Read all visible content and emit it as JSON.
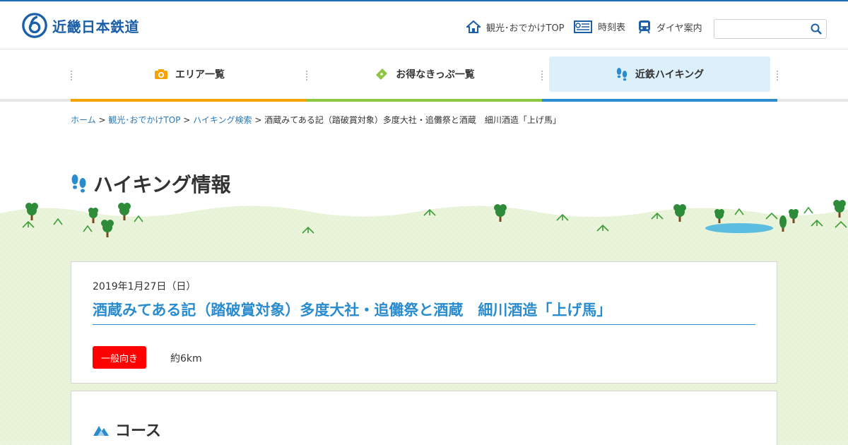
{
  "header": {
    "logo_text": "近畿日本鉄道",
    "links": [
      {
        "label": "観光･おでかけTOP",
        "icon": "house-icon"
      },
      {
        "label": "時刻表",
        "icon": "timetable-icon"
      },
      {
        "label": "ダイヤ案内",
        "icon": "train-icon"
      }
    ],
    "search": {
      "placeholder": "",
      "value": ""
    }
  },
  "nav": {
    "items": [
      {
        "label": "エリア一覧",
        "icon": "camera-icon",
        "bar_color": "#f4a300"
      },
      {
        "label": "お得なきっぷ一覧",
        "icon": "ticket-icon",
        "bar_color": "#8dc63f"
      },
      {
        "label": "近鉄ハイキング",
        "icon": "footprints-icon",
        "bar_color": "#2a8ccf",
        "active": true
      }
    ]
  },
  "breadcrumb": {
    "links": [
      "ホーム",
      "観光･おでかけTOP",
      "ハイキング検索"
    ],
    "separator": ">",
    "current": "酒蔵みてある記（踏破賞対象）多度大社・追儺祭と酒蔵　細川酒造「上げ馬」"
  },
  "page_title": "ハイキング情報",
  "hike": {
    "date": "2019年1月27日（日）",
    "title": "酒蔵みてある記（踏破賞対象）多度大社・追儺祭と酒蔵　細川酒造「上げ馬」",
    "level_badge": "一般向き",
    "distance": "約6km"
  },
  "course": {
    "heading": "コース"
  },
  "colors": {
    "brand_blue": "#1a5fa8",
    "link_blue": "#2a7ab8",
    "title_blue": "#2a8ccf",
    "badge_red": "#ff0000",
    "active_tab_bg": "#dcf0fb",
    "grass": "#e8f3d8"
  }
}
